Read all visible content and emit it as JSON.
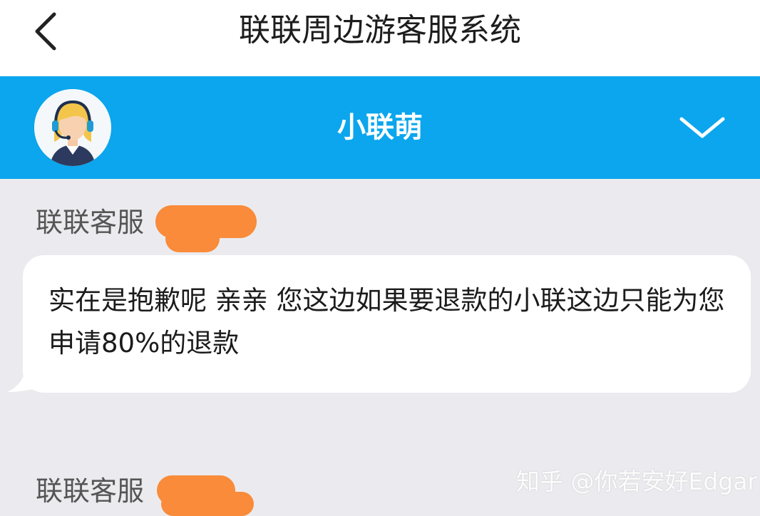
{
  "header": {
    "title": "联联周边游客服系统"
  },
  "agent": {
    "name": "小联萌"
  },
  "messages": [
    {
      "sender": "联联客服",
      "text": "实在是抱歉呢 亲亲 您这边如果要退款的小联这边只能为您申请80%的退款"
    },
    {
      "sender": "联联客服",
      "text": ""
    }
  ],
  "watermark": "知乎 @你若安好Edgar",
  "colors": {
    "header_bar": "#0ba6ed",
    "redaction": "#f98b3a",
    "background": "#ebebef"
  },
  "icons": {
    "back": "chevron-left-icon",
    "expand": "chevron-down-icon",
    "avatar": "agent-headset-avatar"
  }
}
